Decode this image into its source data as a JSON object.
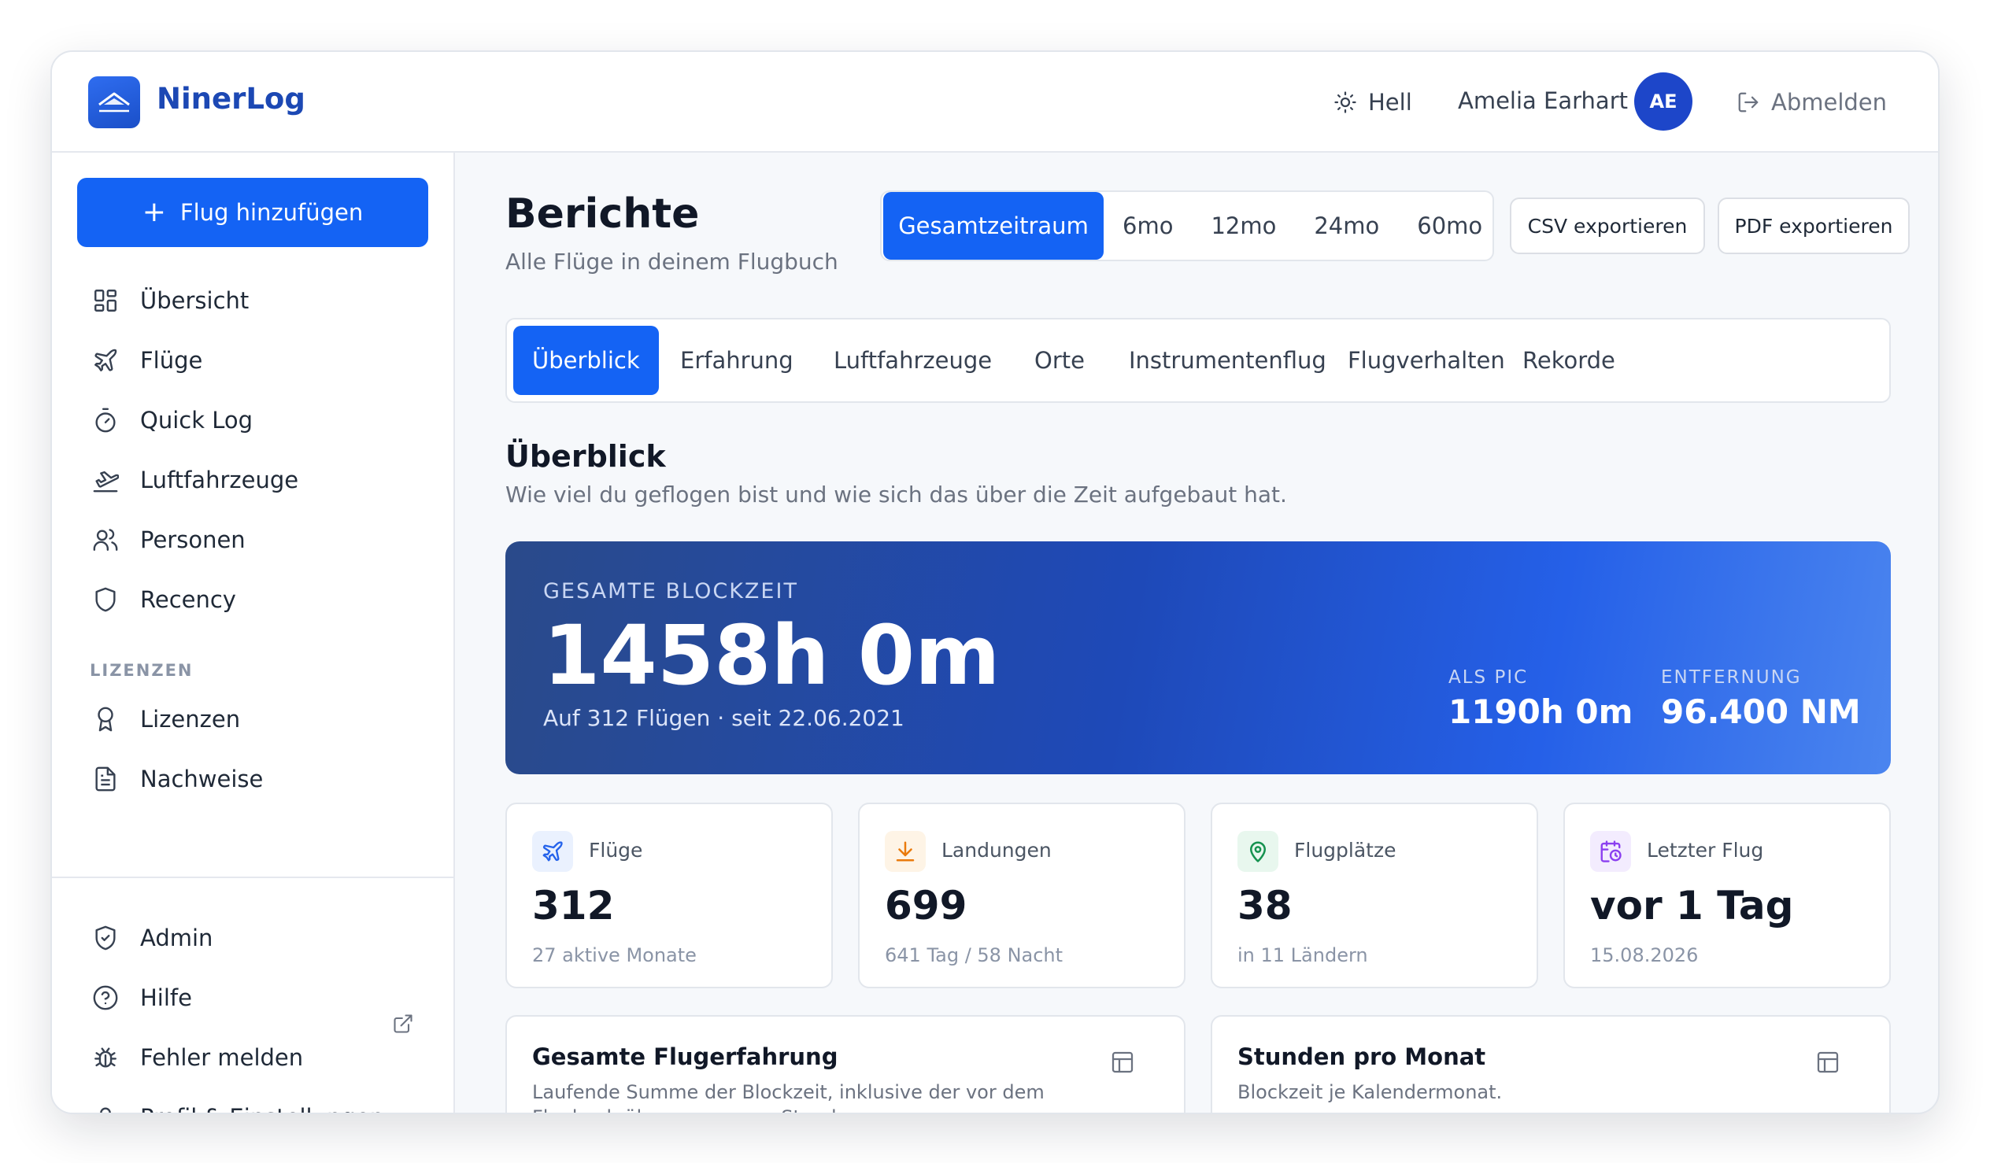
{
  "app": {
    "name": "NinerLog"
  },
  "header": {
    "theme_label": "Hell",
    "user_name": "Amelia Earhart",
    "user_initials": "AE",
    "logout_label": "Abmelden"
  },
  "sidebar": {
    "add_button": "Flug hinzufügen",
    "items": [
      {
        "label": "Übersicht",
        "icon": "grid-icon"
      },
      {
        "label": "Flüge",
        "icon": "plane-icon"
      },
      {
        "label": "Quick Log",
        "icon": "stopwatch-icon"
      },
      {
        "label": "Luftfahrzeuge",
        "icon": "plane-takeoff-icon"
      },
      {
        "label": "Personen",
        "icon": "users-icon"
      },
      {
        "label": "Recency",
        "icon": "shield-icon"
      }
    ],
    "section_label": "LIZENZEN",
    "license_items": [
      {
        "label": "Lizenzen",
        "icon": "award-icon"
      },
      {
        "label": "Nachweise",
        "icon": "document-icon"
      }
    ],
    "bottom_items": [
      {
        "label": "Admin",
        "icon": "shield-check-icon"
      },
      {
        "label": "Hilfe",
        "icon": "help-circle-icon"
      },
      {
        "label": "Fehler melden",
        "icon": "bug-icon"
      },
      {
        "label": "Profil & Einstellungen",
        "icon": "user-icon"
      }
    ]
  },
  "page": {
    "title": "Berichte",
    "subtitle": "Alle Flüge in deinem Flugbuch",
    "ranges": [
      "Gesamtzeitraum",
      "6mo",
      "12mo",
      "24mo",
      "60mo"
    ],
    "active_range": "Gesamtzeitraum",
    "export_csv": "CSV exportieren",
    "export_pdf": "PDF exportieren",
    "tabs": [
      "Überblick",
      "Erfahrung",
      "Luftfahrzeuge",
      "Orte",
      "Instrumentenflug",
      "Flugverhalten",
      "Rekorde"
    ],
    "active_tab": "Überblick",
    "section_title": "Überblick",
    "section_subtitle": "Wie viel du geflogen bist und wie sich das über die Zeit aufgebaut hat."
  },
  "hero": {
    "label": "GESAMTE BLOCKZEIT",
    "value": "1458h 0m",
    "subline": "Auf 312 Flügen · seit 22.06.2021",
    "stats": [
      {
        "label": "ALS PIC",
        "value": "1190h 0m"
      },
      {
        "label": "ENTFERNUNG",
        "value": "96.400 NM"
      }
    ]
  },
  "cards": [
    {
      "label": "Flüge",
      "value": "312",
      "sub": "27 aktive Monate",
      "icon": "plane-icon",
      "color": "#2563eb",
      "bg": "#eaf1fe"
    },
    {
      "label": "Landungen",
      "value": "699",
      "sub": "641 Tag / 58 Nacht",
      "icon": "landing-icon",
      "color": "#ea7a0c",
      "bg": "#fef4e6"
    },
    {
      "label": "Flugplätze",
      "value": "38",
      "sub": "in 11 Ländern",
      "icon": "map-pin-icon",
      "color": "#15924f",
      "bg": "#e8f7ee"
    },
    {
      "label": "Letzter Flug",
      "value": "vor 1 Tag",
      "sub": "15.08.2026",
      "icon": "calendar-clock-icon",
      "color": "#8b3ff0",
      "bg": "#f3ecfe"
    }
  ],
  "panels": [
    {
      "title": "Gesamte Flugerfahrung",
      "subtitle": "Laufende Summe der Blockzeit, inklusive der vor dem Flugbuch übernommenen Stunden."
    },
    {
      "title": "Stunden pro Monat",
      "subtitle": "Blockzeit je Kalendermonat."
    }
  ],
  "colors": {
    "accent": "#1463f4",
    "brand": "#1c48b4"
  }
}
